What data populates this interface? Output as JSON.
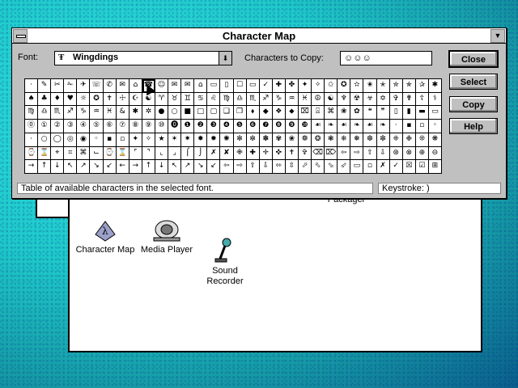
{
  "charmap": {
    "title": "Character Map",
    "font_label": "Font:",
    "font_value": "Wingdings",
    "font_type_glyph": "Ŧ",
    "copy_label": "Characters to Copy:",
    "copy_value": "☺☺☺",
    "buttons": {
      "close": "Close",
      "select": "Select",
      "copy": "Copy",
      "help": "Help"
    },
    "status_text": "Table of available characters in the selected font.",
    "keystroke_text": "Keystroke: )"
  },
  "grid_glyphs": [
    "· ✎ ✂ ✁ ✈ ☏ ✆ ✉ ⌂ ☎ ☺ ✉ ✉ ⌂ ▭ ▯ ☐ ▭ ✓ ✚ ✤ ✦ ✧ ✩ ✪ ✫ ✬ ✭ ✮ ✯ ✰ ✱",
    "♠ ♣ ♦ ♥ ☼ ✪ ✝ ☩ ☪ ☯ ♈ ♉ ♊ ♋ ♌ ♍ ♎ ♏ ♐ ♑ ♒ ♓ ☮ ☯ ♆ ☢ ☣ ✡ ✞ ✟ ☦ ⚕",
    "♍ ♎ ♏ ♐ ♑ ♒ ♓ & ✱ ✲ ● ○ ■ □ ▢ ❑ ❒ ⬧ ◆ ❖ ⬥ ⌧ ⍓ ⌘ ❀ ✿ ❝ ❞ ▯ ▮ ▬ ▭",
    "⓪ ① ② ③ ④ ⑤ ⑥ ⑦ ⑧ ⑨ ⑩ ⓿ ❶ ❷ ❸ ❹ ❺ ❻ ❼ ❽ ❾ ❿ ☙ ❧ ☙ ❧ ☙ ❧ · ▪ ▫ ◦",
    "· ○ ◯ ◎ ◉ ◦ ▪ ▫ ✦ ✧ ★ ✶ ✷ ✸ ✹ ✺ ✻ ✼ ✽ ✾ ❀ ❁ ❂ ❃ ❄ ❅ ❆ ❇ ❈ ❉ ❊ ❋",
    "⌚ ⌛ ⌖ ⌗ ⌘ ⌙ ⌚ ⌛ ⌜ ⌝ ⌞ ⌟ ⌠ ⌡ ✗ ✘ ✙ ✚ ✛ ✜ ✝ ✞ ⌫ ⌦ ⇦ ⇨ ⇧ ⇩ ⊛ ⊗ ⊕ ⊖",
    "→ ↑ ↓ ↖ ↗ ↘ ↙ ← → ↑ ↓ ↖ ↗ ↘ ↙ ⇦ ⇨ ⇧ ⇩ ⬄ ⇳ ⬀ ⬁ ⬂ ⬃ ▭ ▫ ✗ ✓ ☒ ☑ ⊞"
  ],
  "group_icons": [
    {
      "label": "Character Map"
    },
    {
      "label": "Media Player"
    },
    {
      "label": "Sound\nRecorder"
    }
  ],
  "packager_label": "Packager"
}
